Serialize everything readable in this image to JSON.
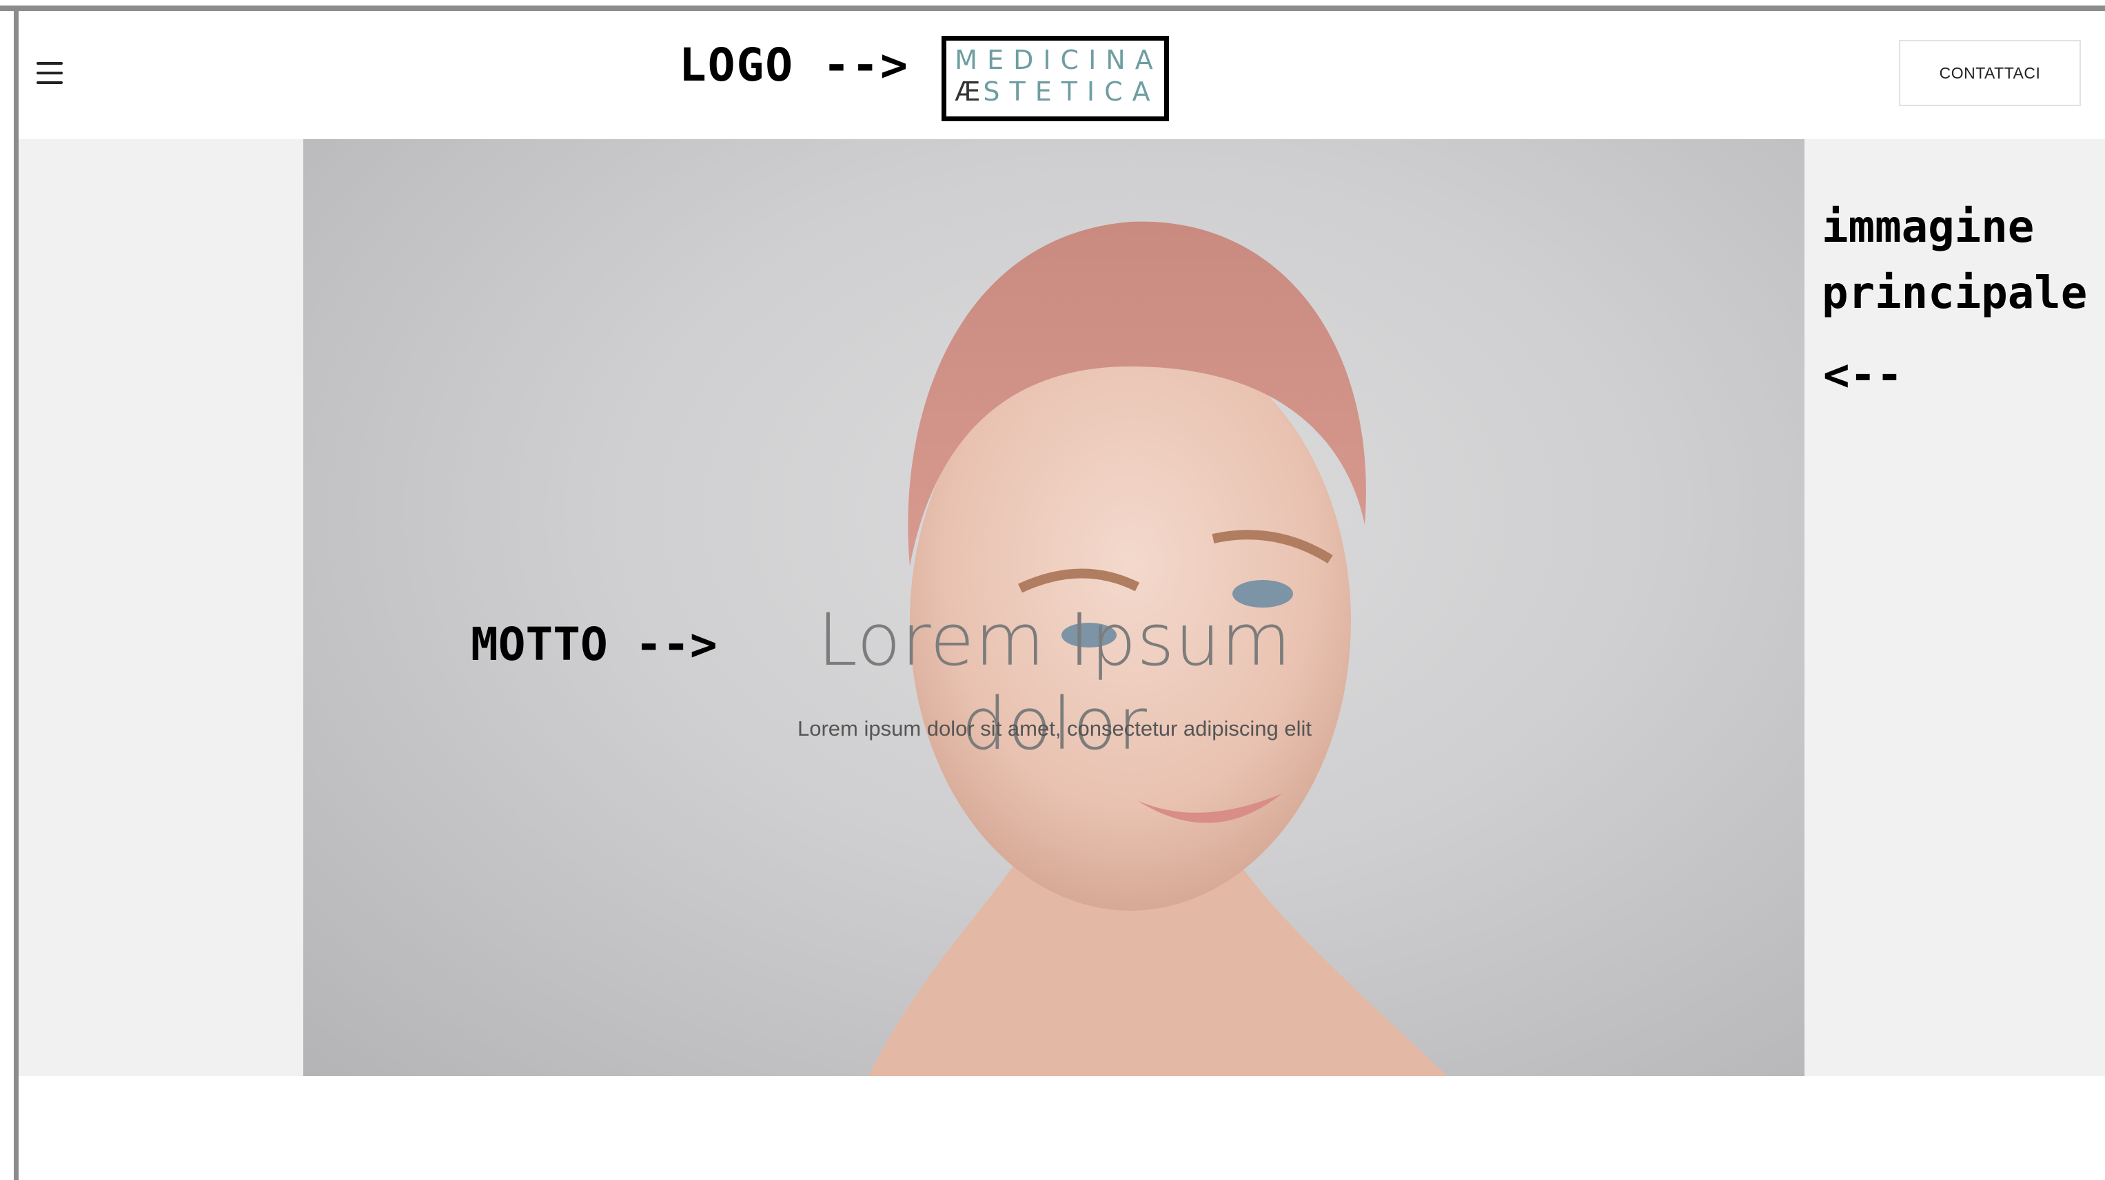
{
  "annotations": {
    "logo": "LOGO  -->",
    "motto": "MOTTO -->",
    "main_image_line1": "immagine",
    "main_image_line2": "principale",
    "main_image_arrow": "<--"
  },
  "header": {
    "menu_icon": "hamburger-menu-icon",
    "logo": {
      "line1": "MEDICINA",
      "ae": "Æ",
      "line2": "STETICA"
    },
    "contact_label": "CONTATTACI"
  },
  "hero": {
    "title": "Lorem Ipsum dolor",
    "subtitle": "Lorem ipsum dolor sit amet, consectetur adipiscing elit"
  },
  "colors": {
    "logo_teal": "#6e9ea2",
    "hero_background": "#f1f1f1",
    "frame": "#8c8c8c"
  }
}
